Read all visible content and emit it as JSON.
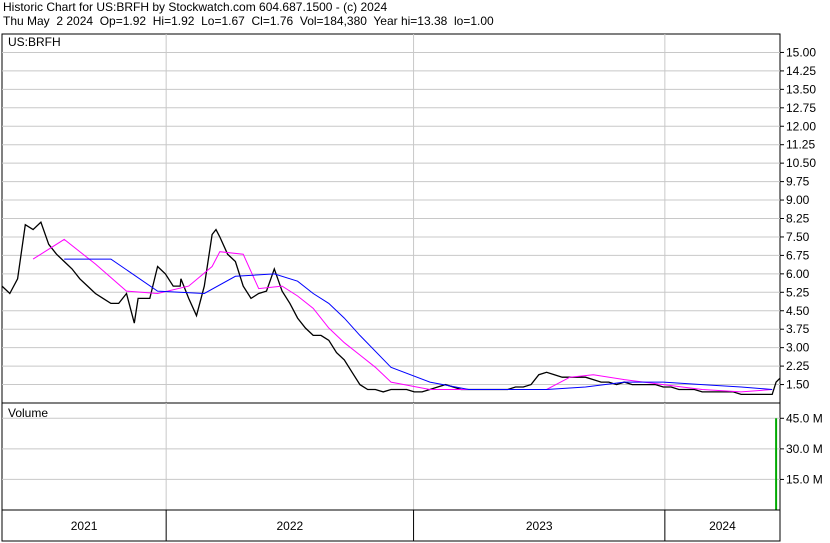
{
  "header": {
    "line1": "Historic Chart for US:BRFH by Stockwatch.com 604.687.1500 - (c) 2024",
    "line2": "Thu May  2 2024  Op=1.92  Hi=1.92  Lo=1.67  Cl=1.76  Vol=184,380  Year hi=13.38  lo=1.00"
  },
  "chart_data": [
    {
      "type": "line",
      "name": "price",
      "panel_label": "US:BRFH",
      "ylim": [
        0.75,
        15.75
      ],
      "y_ticks": [
        "15.00",
        "14.25",
        "13.50",
        "12.75",
        "12.00",
        "11.25",
        "10.50",
        "9.75",
        "9.00",
        "8.25",
        "7.50",
        "6.75",
        "6.00",
        "5.25",
        "4.50",
        "3.75",
        "3.00",
        "2.25",
        "1.50"
      ],
      "x_labels": [
        "2021",
        "2022",
        "2023",
        "2024"
      ],
      "x_dividers": [
        0.211,
        0.529,
        0.852
      ],
      "grid": true,
      "series": [
        {
          "color": "#000000",
          "x": [
            0.0,
            0.01,
            0.02,
            0.03,
            0.04,
            0.05,
            0.06,
            0.07,
            0.08,
            0.09,
            0.1,
            0.11,
            0.12,
            0.13,
            0.14,
            0.15,
            0.16,
            0.17,
            0.175,
            0.18,
            0.19,
            0.2,
            0.21,
            0.22,
            0.229,
            0.23,
            0.24,
            0.25,
            0.26,
            0.27,
            0.275,
            0.28,
            0.29,
            0.3,
            0.31,
            0.32,
            0.33,
            0.34,
            0.35,
            0.36,
            0.37,
            0.38,
            0.39,
            0.4,
            0.41,
            0.42,
            0.43,
            0.44,
            0.45,
            0.46,
            0.47,
            0.48,
            0.49,
            0.5,
            0.51,
            0.52,
            0.53,
            0.54,
            0.55,
            0.56,
            0.57,
            0.58,
            0.59,
            0.6,
            0.61,
            0.62,
            0.63,
            0.64,
            0.65,
            0.66,
            0.67,
            0.68,
            0.69,
            0.7,
            0.71,
            0.72,
            0.73,
            0.74,
            0.75,
            0.76,
            0.77,
            0.78,
            0.79,
            0.8,
            0.81,
            0.82,
            0.83,
            0.84,
            0.85,
            0.86,
            0.87,
            0.88,
            0.89,
            0.9,
            0.91,
            0.92,
            0.93,
            0.94,
            0.95,
            0.96,
            0.97,
            0.98,
            0.99,
            0.995,
            1.0
          ],
          "values": [
            5.5,
            5.2,
            5.8,
            8.0,
            7.8,
            8.1,
            7.2,
            6.8,
            6.5,
            6.2,
            5.8,
            5.5,
            5.2,
            5.0,
            4.8,
            4.8,
            5.2,
            4.0,
            5.0,
            5.0,
            5.0,
            6.3,
            6.0,
            5.5,
            5.5,
            5.8,
            5.0,
            4.3,
            5.5,
            7.6,
            7.8,
            7.5,
            6.8,
            6.5,
            5.5,
            5.0,
            5.2,
            5.3,
            6.2,
            5.3,
            4.8,
            4.2,
            3.8,
            3.5,
            3.5,
            3.3,
            2.8,
            2.5,
            2.0,
            1.5,
            1.3,
            1.3,
            1.2,
            1.3,
            1.3,
            1.3,
            1.2,
            1.2,
            1.3,
            1.4,
            1.5,
            1.4,
            1.3,
            1.3,
            1.3,
            1.3,
            1.3,
            1.3,
            1.3,
            1.4,
            1.4,
            1.5,
            1.9,
            2.0,
            1.9,
            1.8,
            1.8,
            1.8,
            1.8,
            1.7,
            1.6,
            1.6,
            1.5,
            1.6,
            1.5,
            1.5,
            1.5,
            1.5,
            1.4,
            1.4,
            1.3,
            1.3,
            1.3,
            1.2,
            1.2,
            1.2,
            1.2,
            1.2,
            1.1,
            1.1,
            1.1,
            1.1,
            1.1,
            1.6,
            1.76
          ]
        },
        {
          "color": "#ff00ff",
          "x": [
            0.04,
            0.08,
            0.12,
            0.16,
            0.2,
            0.24,
            0.27,
            0.28,
            0.31,
            0.33,
            0.36,
            0.38,
            0.4,
            0.42,
            0.44,
            0.46,
            0.48,
            0.5,
            0.55,
            0.6,
            0.65,
            0.7,
            0.73,
            0.76,
            0.8,
            0.85,
            0.9,
            0.95,
            0.99
          ],
          "values": [
            6.6,
            7.4,
            6.4,
            5.3,
            5.2,
            5.5,
            6.3,
            6.9,
            6.8,
            5.4,
            5.5,
            5.1,
            4.6,
            3.8,
            3.2,
            2.7,
            2.2,
            1.6,
            1.3,
            1.3,
            1.3,
            1.3,
            1.8,
            1.9,
            1.7,
            1.5,
            1.3,
            1.2,
            1.3
          ]
        },
        {
          "color": "#0000ff",
          "x": [
            0.08,
            0.14,
            0.2,
            0.26,
            0.3,
            0.35,
            0.38,
            0.4,
            0.42,
            0.44,
            0.46,
            0.5,
            0.55,
            0.6,
            0.65,
            0.7,
            0.75,
            0.8,
            0.85,
            0.9,
            0.95,
            0.99
          ],
          "values": [
            6.6,
            6.6,
            5.3,
            5.2,
            5.9,
            6.0,
            5.7,
            5.2,
            4.8,
            4.2,
            3.5,
            2.2,
            1.6,
            1.3,
            1.3,
            1.3,
            1.4,
            1.6,
            1.6,
            1.5,
            1.4,
            1.3
          ]
        }
      ]
    },
    {
      "type": "bar",
      "name": "volume",
      "panel_label": "Volume",
      "ylim": [
        0,
        52.5
      ],
      "y_ticks": [
        "45.0 M",
        "30.0 M",
        "15.0 M"
      ],
      "bar_color": "#00aa00",
      "spikes": [
        {
          "x": 0.995,
          "value": 45.0
        }
      ],
      "baseline_value": 0.3
    }
  ]
}
